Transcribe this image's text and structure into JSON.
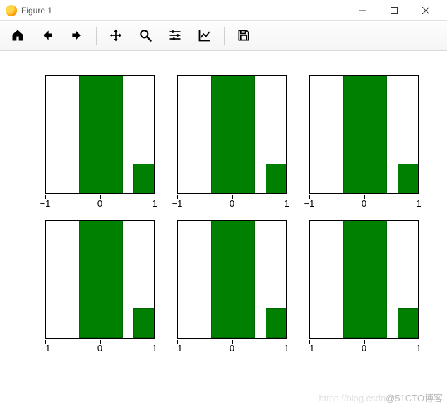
{
  "window": {
    "title": "Figure 1"
  },
  "toolbar": {
    "icons": {
      "home": "home-icon",
      "back": "back-icon",
      "forward": "forward-icon",
      "pan": "pan-icon",
      "zoom": "zoom-icon",
      "config": "config-icon",
      "axes": "axes-icon",
      "save": "save-icon"
    }
  },
  "watermark": {
    "faint": "https://blog.csdn",
    "main": "@51CTO博客"
  },
  "chart_data": [
    {
      "type": "bar",
      "x": [
        0,
        1
      ],
      "values": [
        1.0,
        0.25
      ],
      "xlim": [
        -1,
        1
      ],
      "ylim": [
        0,
        1
      ],
      "xticks": [
        -1,
        0,
        1
      ],
      "color": "#008000",
      "bar_width": 0.8
    },
    {
      "type": "bar",
      "x": [
        0,
        1
      ],
      "values": [
        1.0,
        0.25
      ],
      "xlim": [
        -1,
        1
      ],
      "ylim": [
        0,
        1
      ],
      "xticks": [
        -1,
        0,
        1
      ],
      "color": "#008000",
      "bar_width": 0.8
    },
    {
      "type": "bar",
      "x": [
        0,
        1
      ],
      "values": [
        1.0,
        0.25
      ],
      "xlim": [
        -1,
        1
      ],
      "ylim": [
        0,
        1
      ],
      "xticks": [
        -1,
        0,
        1
      ],
      "color": "#008000",
      "bar_width": 0.8
    },
    {
      "type": "bar",
      "x": [
        0,
        1
      ],
      "values": [
        1.0,
        0.25
      ],
      "xlim": [
        -1,
        1
      ],
      "ylim": [
        0,
        1
      ],
      "xticks": [
        -1,
        0,
        1
      ],
      "color": "#008000",
      "bar_width": 0.8
    },
    {
      "type": "bar",
      "x": [
        0,
        1
      ],
      "values": [
        1.0,
        0.25
      ],
      "xlim": [
        -1,
        1
      ],
      "ylim": [
        0,
        1
      ],
      "xticks": [
        -1,
        0,
        1
      ],
      "color": "#008000",
      "bar_width": 0.8
    },
    {
      "type": "bar",
      "x": [
        0,
        1
      ],
      "values": [
        1.0,
        0.25
      ],
      "xlim": [
        -1,
        1
      ],
      "ylim": [
        0,
        1
      ],
      "xticks": [
        -1,
        0,
        1
      ],
      "color": "#008000",
      "bar_width": 0.8
    }
  ]
}
